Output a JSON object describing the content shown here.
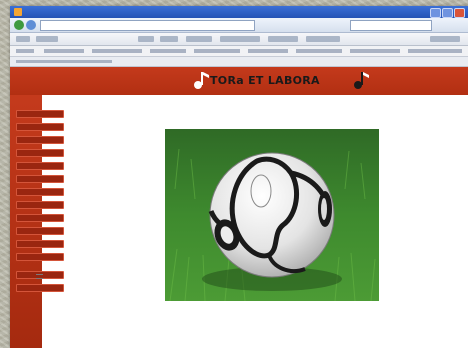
{
  "browser": {
    "window_title": "",
    "address": "",
    "colors": {
      "titlebar": "#2453b5",
      "chrome": "#d6e0ee"
    }
  },
  "site": {
    "title": "TORa ET LABORA",
    "colors": {
      "brand_red": "#c43a1c",
      "menu_button": "#9a2610"
    },
    "menu": {
      "items": [
        "",
        "",
        "",
        "",
        "",
        "",
        "",
        "",
        "",
        "",
        "",
        ""
      ],
      "extra_items": [
        "",
        ""
      ]
    },
    "main_image": {
      "icon": "soccer-ball-on-grass"
    }
  }
}
